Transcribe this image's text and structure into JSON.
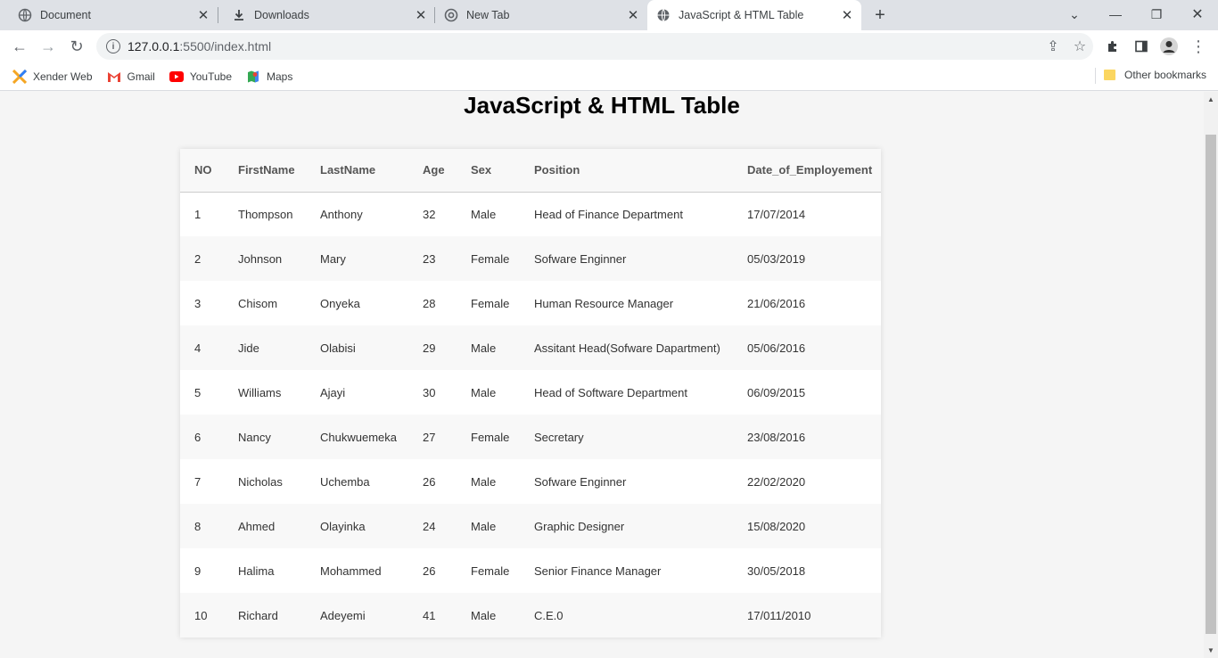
{
  "browser": {
    "tabs": [
      {
        "label": "Document",
        "icon": "globe-icon"
      },
      {
        "label": "Downloads",
        "icon": "download-icon"
      },
      {
        "label": "New Tab",
        "icon": "chrome-icon"
      },
      {
        "label": "JavaScript & HTML Table",
        "icon": "globe-icon",
        "active": true
      }
    ],
    "address": {
      "host": "127.0.0.1",
      "rest": ":5500/index.html"
    },
    "bookmarks": [
      {
        "label": "Xender Web",
        "icon": "xender-icon"
      },
      {
        "label": "Gmail",
        "icon": "gmail-icon"
      },
      {
        "label": "YouTube",
        "icon": "youtube-icon"
      },
      {
        "label": "Maps",
        "icon": "maps-icon"
      }
    ],
    "other_bookmarks": "Other bookmarks"
  },
  "page": {
    "title": "JavaScript & HTML Table",
    "table": {
      "headers": [
        "NO",
        "FirstName",
        "LastName",
        "Age",
        "Sex",
        "Position",
        "Date_of_Employement"
      ],
      "rows": [
        [
          "1",
          "Thompson",
          "Anthony",
          "32",
          "Male",
          "Head of Finance Department",
          "17/07/2014"
        ],
        [
          "2",
          "Johnson",
          "Mary",
          "23",
          "Female",
          "Sofware Enginner",
          "05/03/2019"
        ],
        [
          "3",
          "Chisom",
          "Onyeka",
          "28",
          "Female",
          "Human Resource Manager",
          "21/06/2016"
        ],
        [
          "4",
          "Jide",
          "Olabisi",
          "29",
          "Male",
          "Assitant Head(Sofware Dapartment)",
          "05/06/2016"
        ],
        [
          "5",
          "Williams",
          "Ajayi",
          "30",
          "Male",
          "Head of Software Department",
          "06/09/2015"
        ],
        [
          "6",
          "Nancy",
          "Chukwuemeka",
          "27",
          "Female",
          "Secretary",
          "23/08/2016"
        ],
        [
          "7",
          "Nicholas",
          "Uchemba",
          "26",
          "Male",
          "Sofware Enginner",
          "22/02/2020"
        ],
        [
          "8",
          "Ahmed",
          "Olayinka",
          "24",
          "Male",
          "Graphic Designer",
          "15/08/2020"
        ],
        [
          "9",
          "Halima",
          "Mohammed",
          "26",
          "Female",
          "Senior Finance Manager",
          "30/05/2018"
        ],
        [
          "10",
          "Richard",
          "Adeyemi",
          "41",
          "Male",
          "C.E.0",
          "17/011/2010"
        ]
      ]
    }
  }
}
